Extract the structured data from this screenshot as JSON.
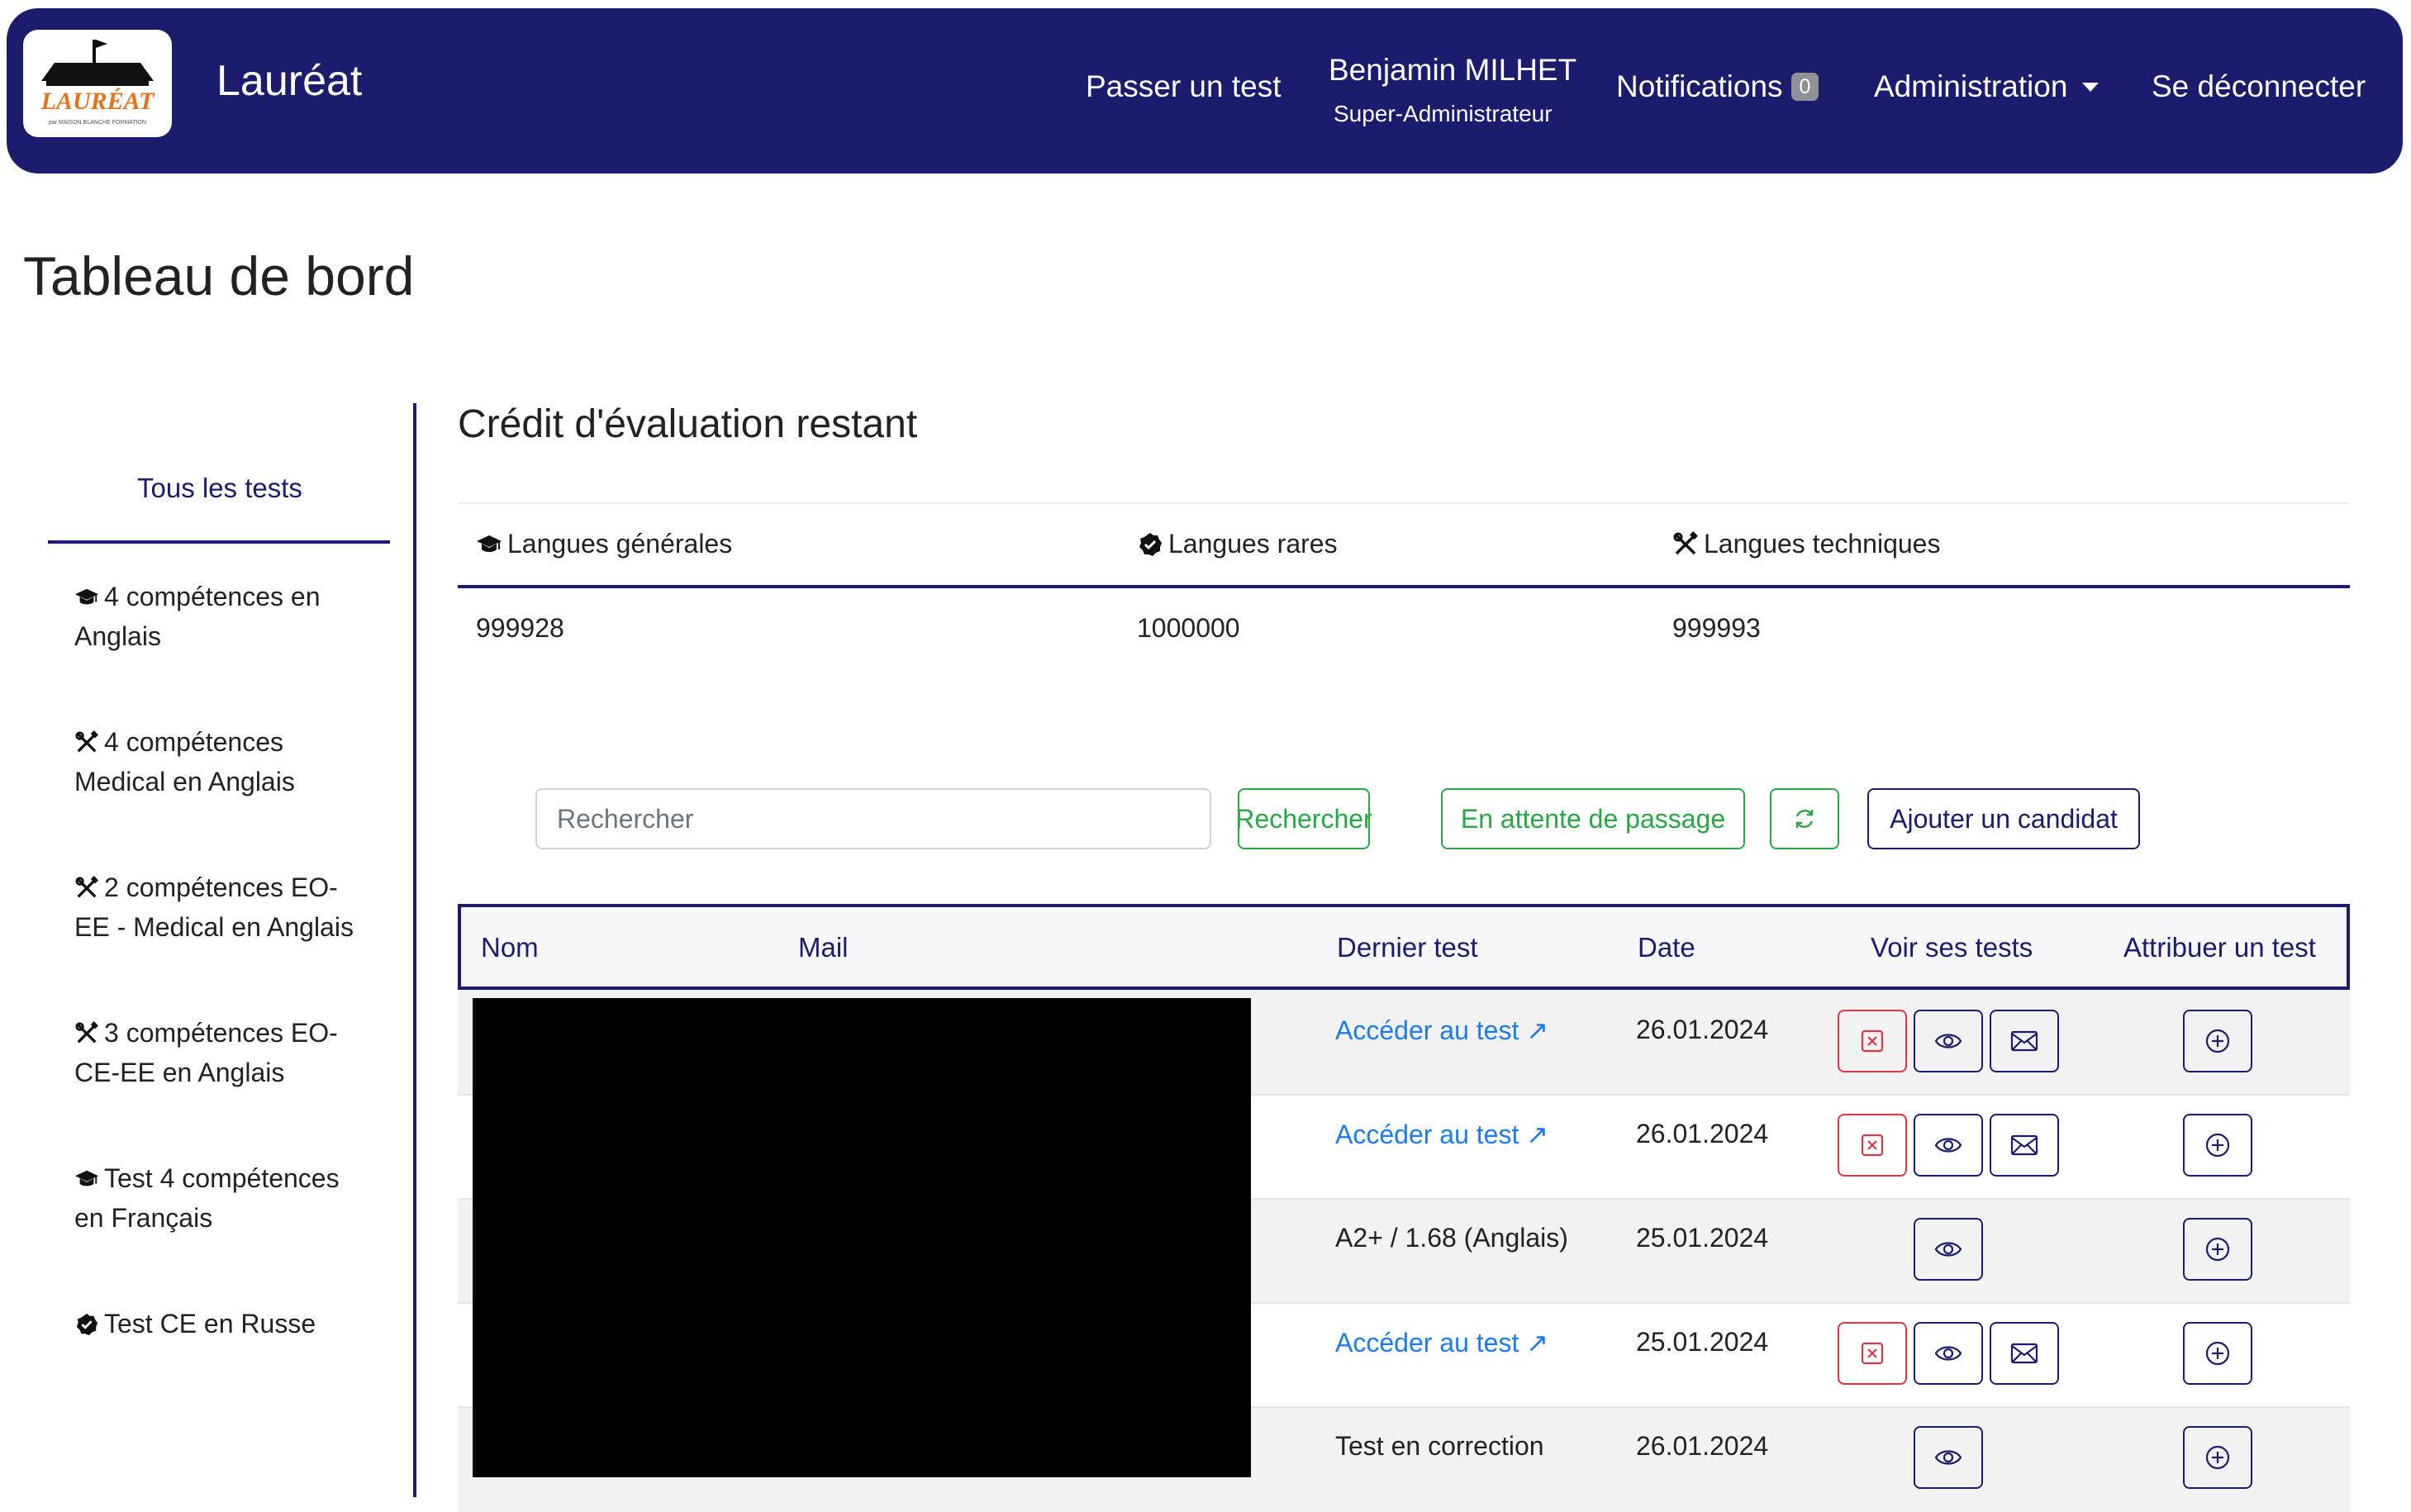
{
  "header": {
    "brand": "Lauréat",
    "logo_text": "LAURÉAT",
    "logo_subtext": "par MAISON BLANCHE FORMATION",
    "nav": {
      "passer": "Passer un test",
      "user_name": "Benjamin MILHET",
      "user_role": "Super-Administrateur",
      "notifications": "Notifications",
      "notifications_count": "0",
      "administration": "Administration",
      "logout": "Se déconnecter"
    }
  },
  "page": {
    "title": "Tableau de bord"
  },
  "sidebar": {
    "all_tests": "Tous les tests",
    "items": [
      {
        "icon": "graduation-cap-icon",
        "label": "4 compétences en Anglais"
      },
      {
        "icon": "tools-icon",
        "label": "4 compétences Medical en Anglais"
      },
      {
        "icon": "tools-icon",
        "label": "2 compétences EO-EE - Medical en Anglais"
      },
      {
        "icon": "tools-icon",
        "label": "3 compétences EO-CE-EE en Anglais"
      },
      {
        "icon": "graduation-cap-icon",
        "label": "Test 4 compétences en Français"
      },
      {
        "icon": "badge-check-icon",
        "label": "Test CE en Russe"
      }
    ]
  },
  "credit": {
    "title": "Crédit d'évaluation restant",
    "columns": [
      {
        "icon": "graduation-cap-icon",
        "label": "Langues générales",
        "value": "999928"
      },
      {
        "icon": "badge-check-icon",
        "label": "Langues rares",
        "value": "1000000"
      },
      {
        "icon": "tools-icon",
        "label": "Langues techniques",
        "value": "999993"
      }
    ]
  },
  "toolbar": {
    "search_placeholder": "Rechercher",
    "search_button": "Rechercher",
    "waiting_button": "En attente de passage",
    "add_button": "Ajouter un candidat"
  },
  "table": {
    "headers": {
      "nom": "Nom",
      "mail": "Mail",
      "dernier_test": "Dernier test",
      "date": "Date",
      "voir": "Voir ses tests",
      "attribuer": "Attribuer un test"
    },
    "rows": [
      {
        "last_test": "Accéder au test ↗",
        "is_link": true,
        "date": "26.01.2024",
        "actions": [
          "cancel",
          "view",
          "mail"
        ]
      },
      {
        "last_test": "Accéder au test ↗",
        "is_link": true,
        "date": "26.01.2024",
        "actions": [
          "cancel",
          "view",
          "mail"
        ]
      },
      {
        "last_test": "A2+ / 1.68 (Anglais)",
        "is_link": false,
        "date": "25.01.2024",
        "actions": [
          "view"
        ]
      },
      {
        "last_test": "Accéder au test ↗",
        "is_link": true,
        "date": "25.01.2024",
        "actions": [
          "cancel",
          "view",
          "mail"
        ]
      },
      {
        "last_test": "Test en correction",
        "is_link": false,
        "date": "26.01.2024",
        "actions": [
          "view"
        ]
      }
    ]
  },
  "colors": {
    "navy": "#1b1c6e",
    "green": "#28a745",
    "red": "#dc3545",
    "link": "#1a7cf0",
    "logo_orange": "#e8711c"
  }
}
